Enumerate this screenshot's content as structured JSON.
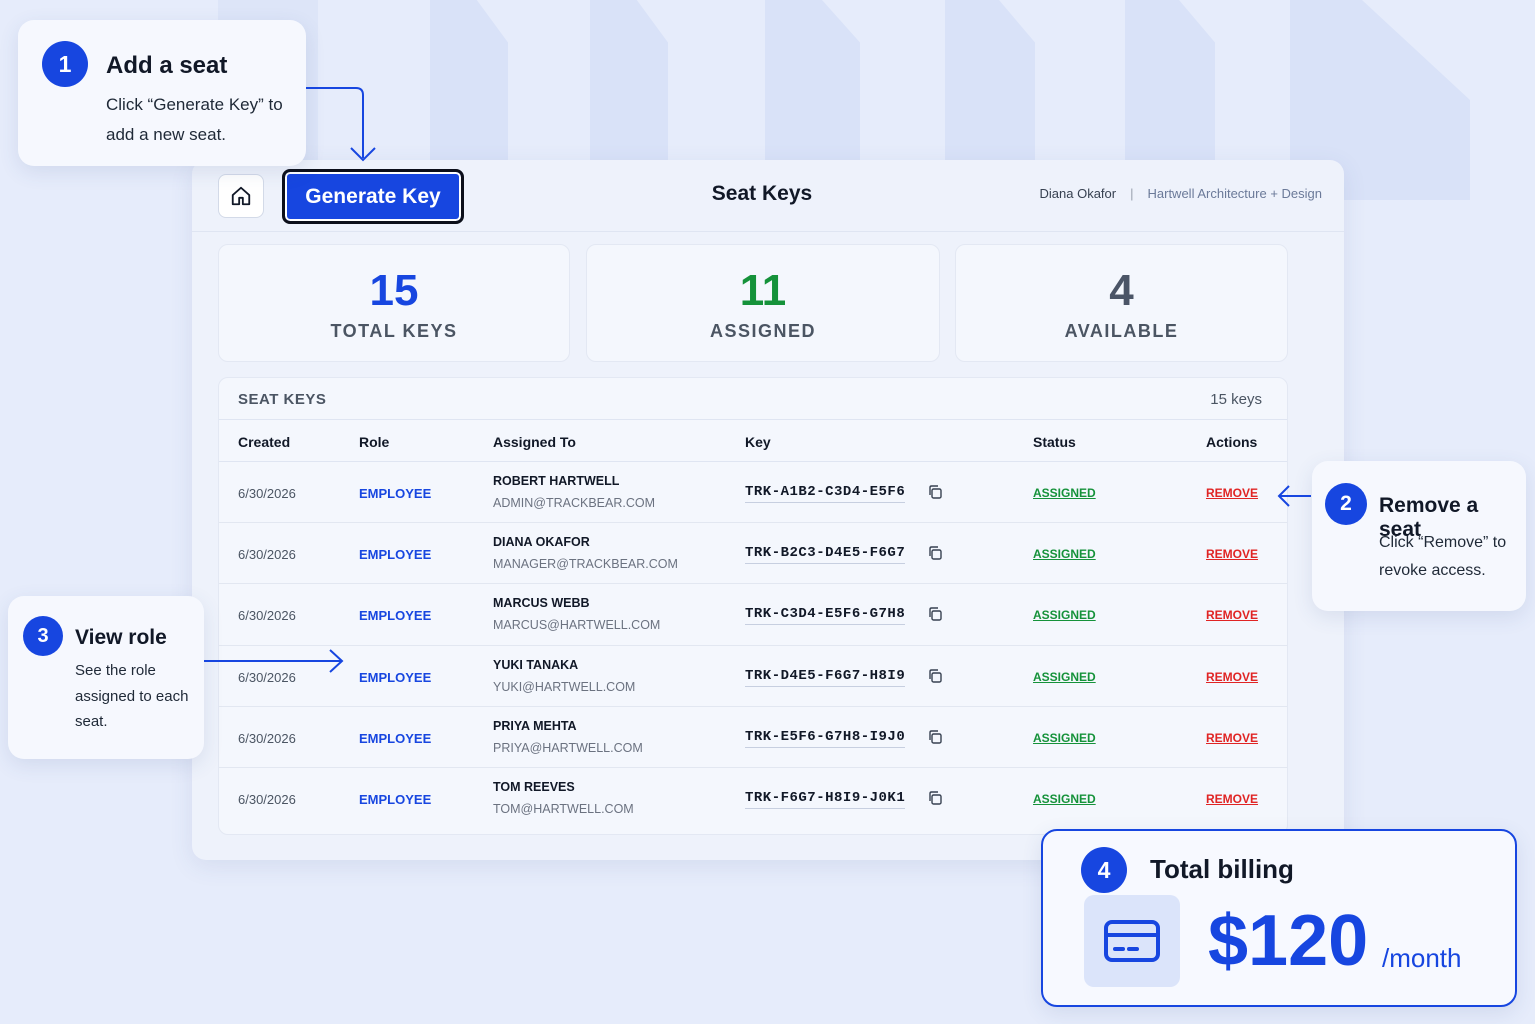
{
  "header": {
    "generate_label": "Generate Key",
    "title": "Seat Keys",
    "user_name": "Diana Okafor",
    "separator": "|",
    "org_name": "Hartwell Architecture + Design"
  },
  "stats": [
    {
      "value": "15",
      "label": "TOTAL KEYS"
    },
    {
      "value": "11",
      "label": "ASSIGNED"
    },
    {
      "value": "4",
      "label": "AVAILABLE"
    }
  ],
  "table": {
    "title": "SEAT KEYS",
    "count": "15 keys",
    "columns": [
      "Created",
      "Role",
      "Assigned To",
      "Key",
      "Status",
      "Actions"
    ],
    "rows": [
      {
        "created": "6/30/2026",
        "role": "EMPLOYEE",
        "name": "ROBERT HARTWELL",
        "email": "ADMIN@TRACKBEAR.COM",
        "key": "TRK-A1B2-C3D4-E5F6",
        "status": "ASSIGNED",
        "action": "REMOVE"
      },
      {
        "created": "6/30/2026",
        "role": "EMPLOYEE",
        "name": "DIANA OKAFOR",
        "email": "MANAGER@TRACKBEAR.COM",
        "key": "TRK-B2C3-D4E5-F6G7",
        "status": "ASSIGNED",
        "action": "REMOVE"
      },
      {
        "created": "6/30/2026",
        "role": "EMPLOYEE",
        "name": "MARCUS WEBB",
        "email": "MARCUS@HARTWELL.COM",
        "key": "TRK-C3D4-E5F6-G7H8",
        "status": "ASSIGNED",
        "action": "REMOVE"
      },
      {
        "created": "6/30/2026",
        "role": "EMPLOYEE",
        "name": "YUKI TANAKA",
        "email": "YUKI@HARTWELL.COM",
        "key": "TRK-D4E5-F6G7-H8I9",
        "status": "ASSIGNED",
        "action": "REMOVE"
      },
      {
        "created": "6/30/2026",
        "role": "EMPLOYEE",
        "name": "PRIYA MEHTA",
        "email": "PRIYA@HARTWELL.COM",
        "key": "TRK-E5F6-G7H8-I9J0",
        "status": "ASSIGNED",
        "action": "REMOVE"
      },
      {
        "created": "6/30/2026",
        "role": "EMPLOYEE",
        "name": "TOM REEVES",
        "email": "TOM@HARTWELL.COM",
        "key": "TRK-F6G7-H8I9-J0K1",
        "status": "ASSIGNED",
        "action": "REMOVE"
      }
    ]
  },
  "callouts": {
    "add": {
      "num": "1",
      "title": "Add a seat",
      "text": "Click “Generate Key” to add a new seat."
    },
    "remove": {
      "num": "2",
      "title": "Remove a seat",
      "text": "Click “Remove” to revoke access."
    },
    "role": {
      "num": "3",
      "title": "View role",
      "text": "See the role assigned to each seat."
    },
    "billing": {
      "num": "4",
      "title": "Total billing",
      "price": "$120",
      "period": "/month"
    }
  },
  "icons": {
    "home": "home-icon",
    "copy": "copy-icon",
    "card": "credit-card-icon"
  },
  "colors": {
    "accent": "#1746e0",
    "assigned": "#15923a",
    "remove": "#e02424",
    "available": "#4b5567"
  }
}
